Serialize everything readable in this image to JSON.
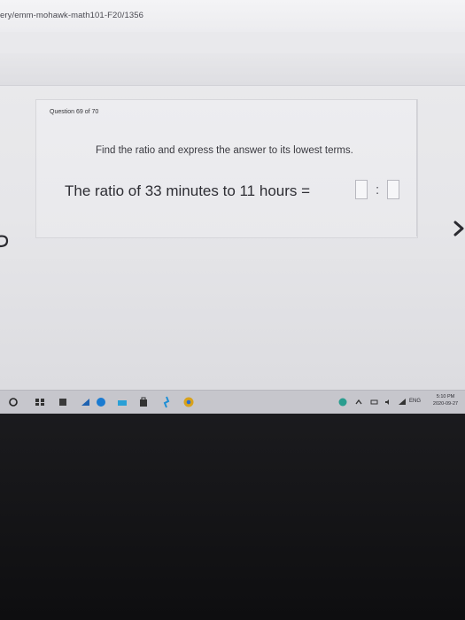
{
  "browser": {
    "url": "ery/emm-mohawk-math101-F20/1356"
  },
  "question": {
    "counter": "Question 69 of 70",
    "instruction": "Find the ratio and express the answer to its lowest terms.",
    "prompt": "The ratio of 33 minutes to 11 hours =",
    "separator": ":"
  },
  "taskbar": {
    "tray_language": "ENG",
    "clock_time": "5:10 PM",
    "clock_date": "2020-09-27"
  },
  "icons": {
    "start": "windows-start-icon",
    "task_view": "task-view-icon",
    "prev": "previous-arrow-icon",
    "next": "next-arrow-icon"
  },
  "colors": {
    "page_bg": "#e8e8eb",
    "text": "#2e2e34",
    "taskbar": "#c6c6cc",
    "bezel": "#111113"
  }
}
